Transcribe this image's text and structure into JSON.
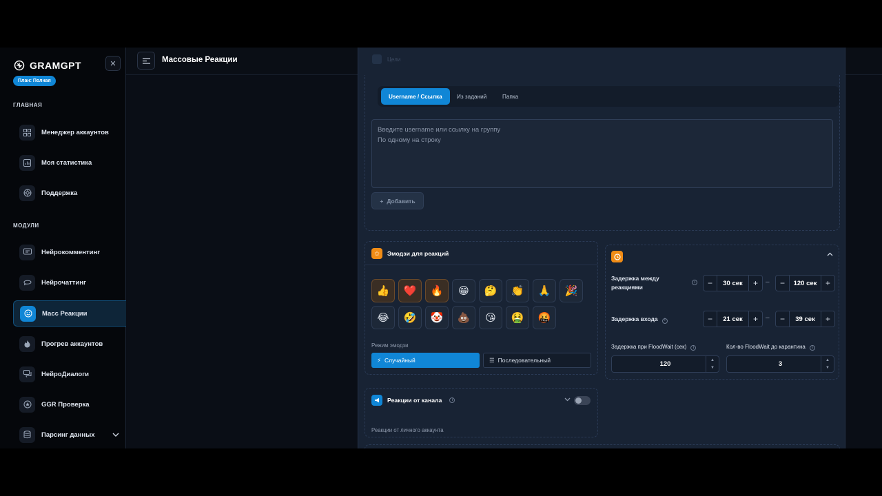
{
  "brand": {
    "name": "GRAMGPT",
    "plan": "План: Полная"
  },
  "sidebar": {
    "section_main": "ГЛАВНАЯ",
    "main_items": [
      {
        "label": "Менеджер аккаунтов",
        "icon": "grid-icon"
      },
      {
        "label": "Моя статистика",
        "icon": "chart-icon"
      },
      {
        "label": "Поддержка",
        "icon": "lifebuoy-icon"
      }
    ],
    "section_modules": "МОДУЛИ",
    "module_items": [
      {
        "label": "Нейрокомментинг",
        "icon": "comments-icon"
      },
      {
        "label": "Нейрочаттинг",
        "icon": "chat-bubble-icon"
      },
      {
        "label": "Масс Реакции",
        "icon": "smile-icon",
        "active": true
      },
      {
        "label": "Прогрев аккаунтов",
        "icon": "fire-icon"
      },
      {
        "label": "НейроДиалоги",
        "icon": "dialogs-icon"
      },
      {
        "label": "GGR Проверка",
        "icon": "star-circle-icon"
      },
      {
        "label": "Парсинг данных",
        "icon": "database-icon"
      }
    ]
  },
  "header": {
    "title": "Массовые Реакции"
  },
  "targets": {
    "ghost_label": "Цели",
    "tabs": [
      "Username / Ссылка",
      "Из заданий",
      "Папка"
    ],
    "placeholder": "Введите username или ссылку на группу\nПо одному на строку",
    "add_label": "Добавить"
  },
  "emoji_section": {
    "title": "Эмодзи для реакций",
    "emojis": [
      "👍",
      "❤️",
      "🔥",
      "😁",
      "🤔",
      "👏",
      "🙏",
      "🎉",
      "😂",
      "🤣",
      "🤡",
      "💩",
      "😘",
      "🤮",
      "🤬"
    ],
    "selected": [
      0,
      1,
      2
    ],
    "mode_label": "Режим эмодзи",
    "mode_random": "Случайный",
    "mode_sequential": "Последовательный"
  },
  "channel_reactions": {
    "title": "Реакции от канала",
    "subtitle": "Реакции от личного аккаунта"
  },
  "delays": {
    "reaction_delay_label": "Задержка между реакциями",
    "reaction_min": "30 сек",
    "reaction_max": "120 сек",
    "join_delay_label": "Задержка входа",
    "join_min": "21 сек",
    "join_max": "39 сек",
    "floodwait_label": "Задержка при FloodWait (сек)",
    "floodwait_value": "120",
    "floodwait_count_label": "Кол-во FloodWait до карантина",
    "floodwait_count_value": "3"
  },
  "colors": {
    "accent": "#1086d6",
    "orange": "#f08c16",
    "panel": "#182334"
  }
}
